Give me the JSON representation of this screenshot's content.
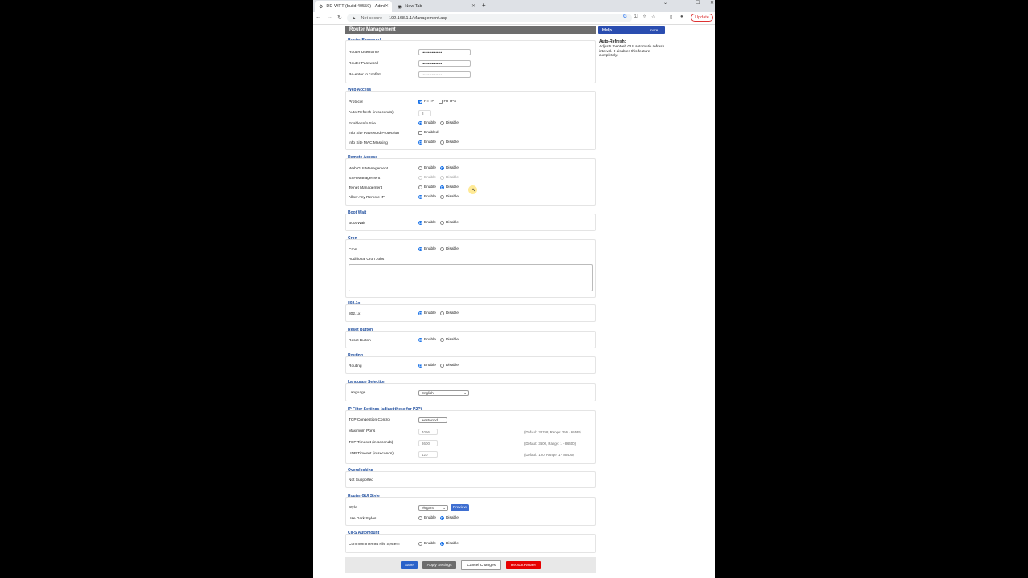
{
  "browser": {
    "tabs": [
      {
        "title": "DD-WRT (build 40559) - Administration...",
        "active": true
      },
      {
        "title": "New Tab",
        "active": false
      }
    ],
    "new_tab_icon": "plus-icon",
    "not_secure": "Not secure",
    "url": "192.168.1.1/Management.asp",
    "update_label": "Update"
  },
  "page": {
    "title": "Router Management",
    "router_password": {
      "legend": "Router Password",
      "username_label": "Router Username",
      "username_value": "••••••••••••••••",
      "password_label": "Router Password",
      "password_value": "••••••••••••••••",
      "confirm_label": "Re-enter to confirm",
      "confirm_value": "••••••••••••••••"
    },
    "web_access": {
      "legend": "Web Access",
      "protocol_label": "Protocol",
      "http_label": "HTTP",
      "https_label": "HTTPS",
      "autorefresh_label": "Auto-Refresh (in seconds)",
      "autorefresh_value": "3",
      "info_site_label": "Enable Info Site",
      "info_pw_label": "Info Site Password Protection",
      "enabled_label": "Enabled",
      "mac_label": "Info Site MAC Masking"
    },
    "remote_access": {
      "legend": "Remote Access",
      "webgui_label": "Web GUI Management",
      "ssh_label": "SSH Management",
      "telnet_label": "Telnet Management",
      "anyip_label": "Allow Any Remote IP"
    },
    "boot_wait": {
      "legend": "Boot Wait",
      "label": "Boot Wait"
    },
    "cron": {
      "legend": "Cron",
      "label": "Cron",
      "jobs_label": "Additional Cron Jobs"
    },
    "dot1x": {
      "legend": "802.1x",
      "label": "802.1x"
    },
    "reset_button": {
      "legend": "Reset Button",
      "label": "Reset Button"
    },
    "routing": {
      "legend": "Routing",
      "label": "Routing"
    },
    "language": {
      "legend": "Language Selection",
      "label": "Language",
      "value": "English"
    },
    "ip_filter": {
      "legend": "IP Filter Settings (adjust these for P2P)",
      "tcp_cc_label": "TCP Congestion Control",
      "tcp_cc_value": "westwood",
      "max_ports_label": "Maximum Ports",
      "max_ports_value": "4096",
      "max_ports_hint": "(Default: 32768, Range: 256 - 65535)",
      "tcp_timeout_label": "TCP Timeout (in seconds)",
      "tcp_timeout_value": "3600",
      "tcp_timeout_hint": "(Default: 3600, Range: 1 - 86400)",
      "udp_timeout_label": "UDP Timeout (in seconds)",
      "udp_timeout_value": "120",
      "udp_timeout_hint": "(Default: 120, Range: 1 - 86400)"
    },
    "overclocking": {
      "legend": "Overclocking",
      "label": "Not Supported"
    },
    "gui_style": {
      "legend": "Router GUI Style",
      "style_label": "Style",
      "style_value": "elegant",
      "preview_label": "Preview",
      "dark_label": "Use Dark Styles"
    },
    "cifs": {
      "legend": "CIFS Automount",
      "label": "Common Internet File System"
    },
    "enable_label": "Enable",
    "disable_label": "Disable",
    "buttons": {
      "save": "Save",
      "apply": "Apply Settings",
      "cancel": "Cancel Changes",
      "reboot": "Reboot Router"
    }
  },
  "help": {
    "header": "Help",
    "more": "more...",
    "title": "Auto-Refresh:",
    "text": "Adjusts the Web GUI automatic refresh interval. 0 disables this feature completely."
  },
  "colors": {
    "legend": "#1f4e9e",
    "help_header": "#2a4db0",
    "save_button": "#2a62c9",
    "apply_button": "#6d6d6d",
    "reboot_button": "#e60000"
  }
}
